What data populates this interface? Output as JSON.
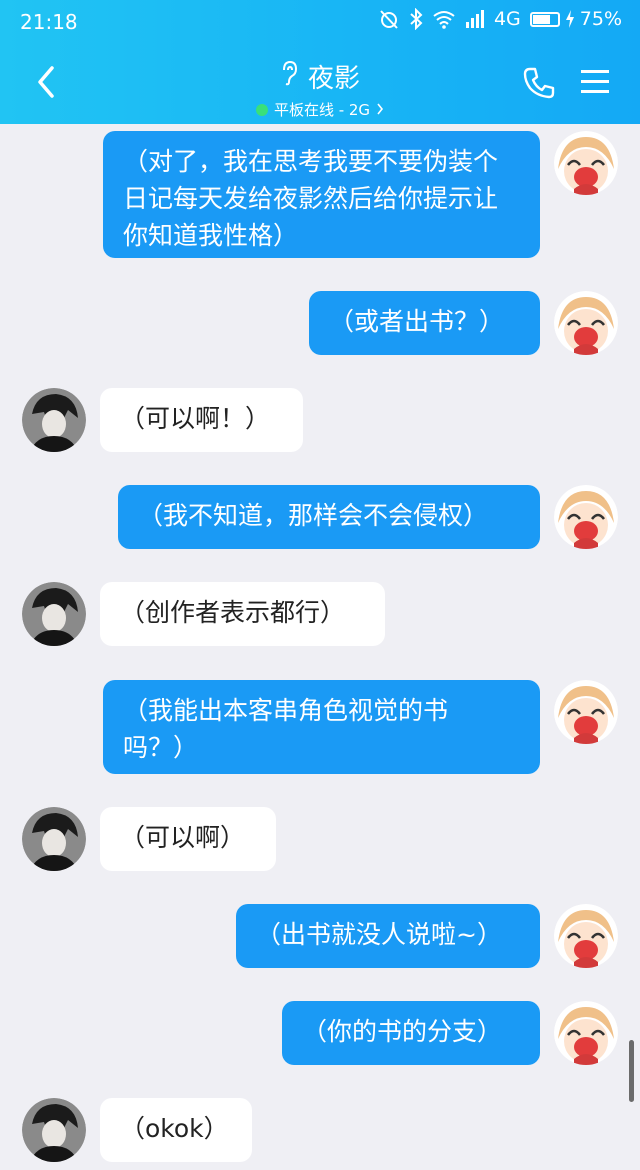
{
  "status_bar": {
    "time": "21:18",
    "network": "4G",
    "battery": "75%",
    "battery_level": 0.75
  },
  "header": {
    "contact_name": "夜影",
    "status": "平板在线 - 2G",
    "colors": {
      "bar": "#18b5f5",
      "online": "#39e07a"
    }
  },
  "icons": {
    "back": "chevron-left-icon",
    "ear": "ear-icon",
    "phone": "phone-icon",
    "menu": "menu-icon"
  },
  "messages": [
    {
      "side": "out",
      "text": "（对了，我在思考我要不要伪装个日记每天发给夜影然后给你提示让你知道我性格）"
    },
    {
      "side": "out",
      "text": "（或者出书？）"
    },
    {
      "side": "in",
      "text": "（可以啊！）"
    },
    {
      "side": "out",
      "text": "（我不知道，那样会不会侵权）"
    },
    {
      "side": "in",
      "text": "（创作者表示都行）"
    },
    {
      "side": "out",
      "text": "（我能出本客串角色视觉的书吗？）"
    },
    {
      "side": "in",
      "text": "（可以啊）"
    },
    {
      "side": "out",
      "text": "（出书就没人说啦~）"
    },
    {
      "side": "out",
      "text": "（你的书的分支）"
    },
    {
      "side": "in",
      "text": "（okok）"
    }
  ],
  "bubble_colors": {
    "out": "#1a9af5",
    "in": "#ffffff"
  }
}
